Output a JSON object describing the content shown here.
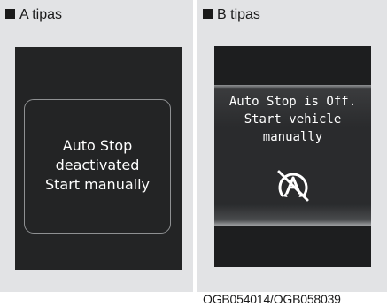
{
  "panel_a": {
    "caption": "A tipas",
    "message": {
      "line1": "Auto Stop",
      "line2": "deactivated",
      "line3": "Start manually"
    }
  },
  "panel_b": {
    "caption": "B tipas",
    "message": {
      "line1": "Auto Stop is Off.",
      "line2": "Start vehicle",
      "line3": "manually"
    },
    "icon": "auto-stop-off-icon"
  },
  "reference_code": "OGB054014/OGB058039"
}
